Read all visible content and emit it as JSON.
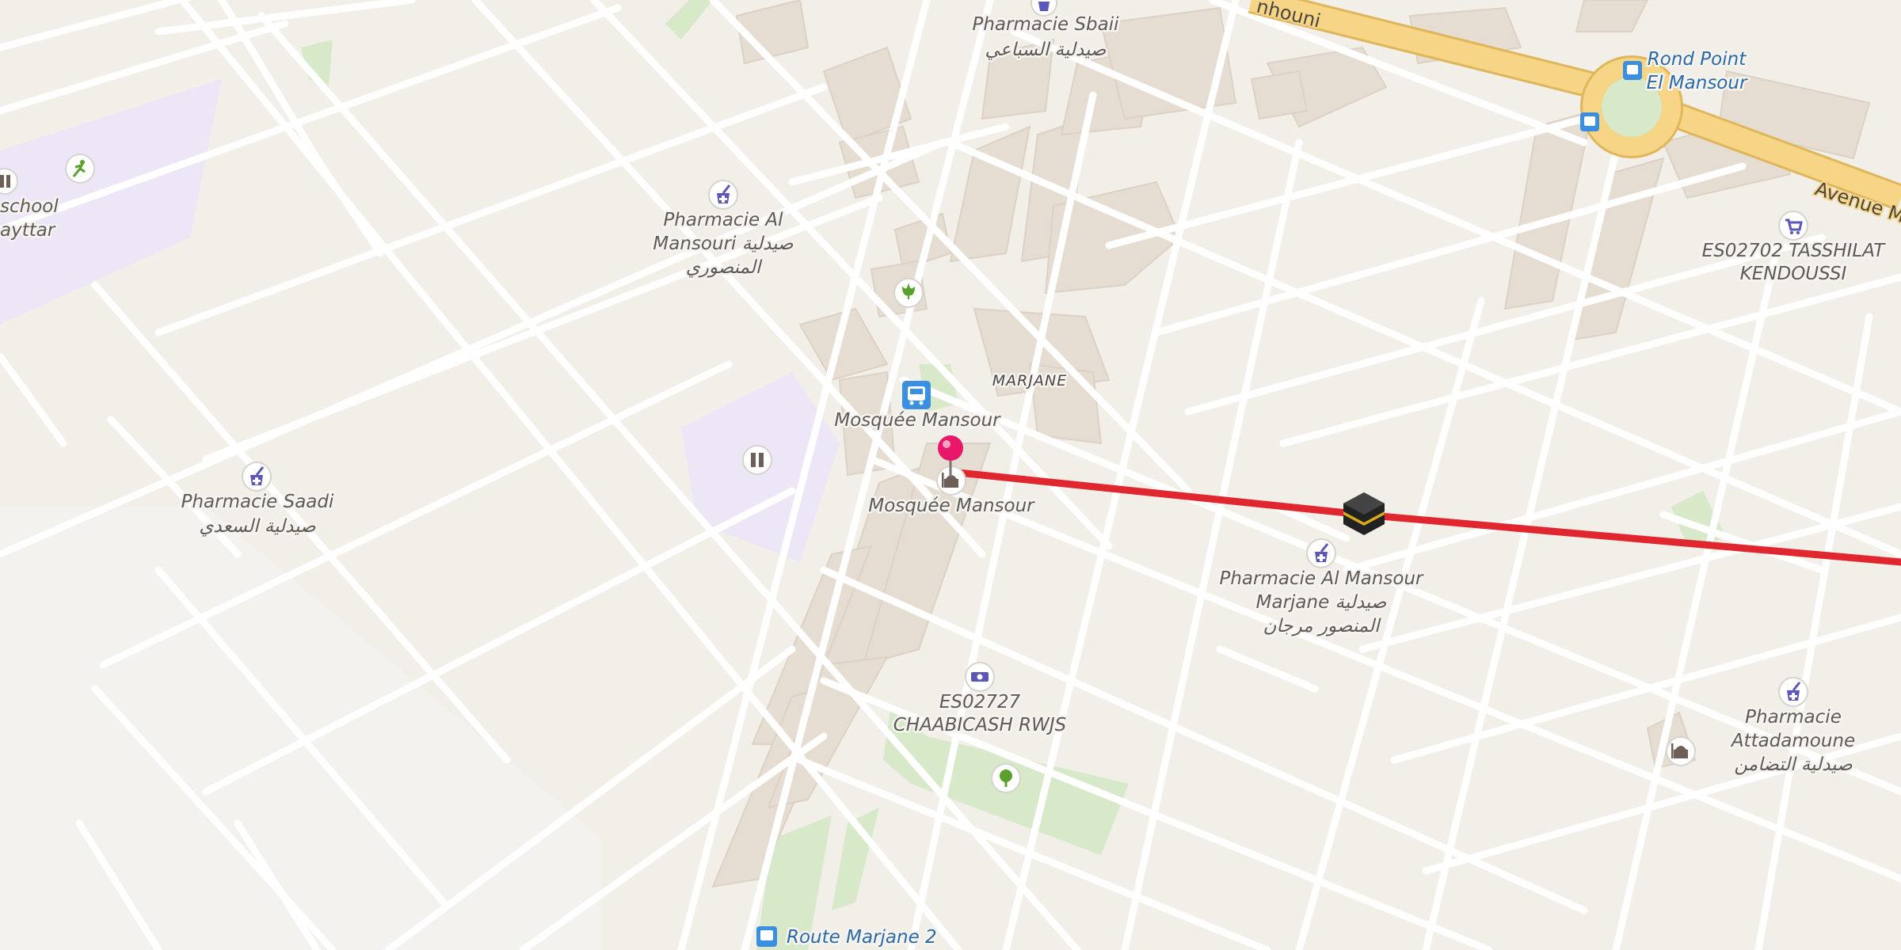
{
  "map": {
    "colors": {
      "land": "#f2efe9",
      "minor_road": "#ffffff",
      "major_road": "#f6d587",
      "major_road_casing": "#e0b65a",
      "building": "#e6ddd2",
      "park": "#d7e9c8",
      "school_area": "#ece6f7",
      "route_line": "#e0272f",
      "pin": "#e8176a",
      "bus_blue": "#3b8fe0",
      "pharmacy_icon": "#5b57b8"
    },
    "route": {
      "type": "line"
    }
  },
  "labels": {
    "avenue_top": "nhouni",
    "avenue_right": "Avenue M",
    "rond_point": "Rond Point El Mansour",
    "pharmacie_sbaii": "Pharmacie Sbaii",
    "pharmacie_sbaii_ar": "صيدلية السباعي",
    "pharmacie_al_mansouri_1": "Pharmacie Al",
    "pharmacie_al_mansouri_2": "Mansouri صيدلية",
    "pharmacie_al_mansouri_3": "المنصوري",
    "school_1": "school",
    "school_2": "ayttar",
    "marjane": "MARJANE",
    "mosquee_stop": "Mosquée Mansour",
    "mosquee": "Mosquée Mansour",
    "pharmacie_saadi": "Pharmacie Saadi",
    "pharmacie_saadi_ar": "صيدلية السعدي",
    "es02702_1": "ES02702 TASSHILAT",
    "es02702_2": "KENDOUSSI",
    "pharmacie_marjane_1": "Pharmacie Al Mansour",
    "pharmacie_marjane_2": "Marjane صيدلية",
    "pharmacie_marjane_3": "المنصور مرجان",
    "es02727_1": "ES02727",
    "es02727_2": "CHAABICASH RWJS",
    "pharmacie_attadamoune_1": "Pharmacie",
    "pharmacie_attadamoune_2": "Attadamoune",
    "pharmacie_attadamoune_3": "صيدلية التضامن",
    "route_marjane": "Route Marjane 2"
  },
  "icons": [
    "pharmacy-icon",
    "bus-stop-icon",
    "mosque-icon",
    "school-icon",
    "sports-icon",
    "florist-icon",
    "shopping-cart-icon",
    "bank-icon",
    "park-tree-icon",
    "kaaba-icon",
    "location-pin-icon"
  ]
}
